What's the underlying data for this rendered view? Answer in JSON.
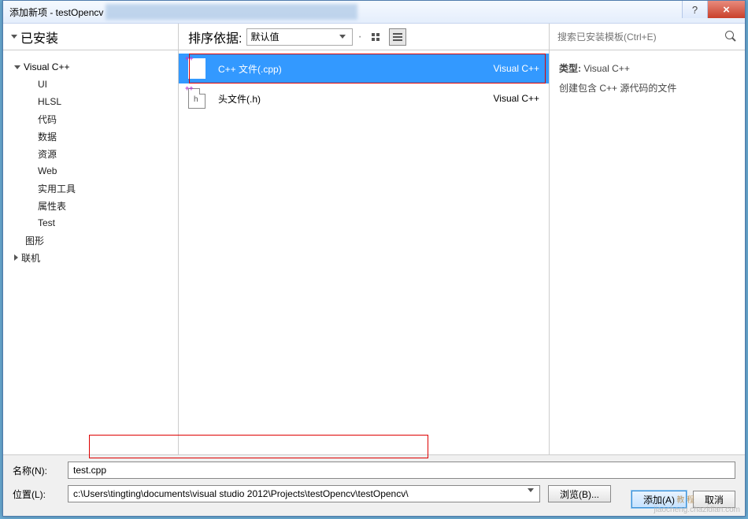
{
  "title": "添加新项 - testOpencv",
  "titlebar": {
    "help": "?",
    "close": "×"
  },
  "toolbar": {
    "installed": "已安装",
    "sort_label": "排序依据:",
    "sort_value": "默认值",
    "search_placeholder": "搜索已安装模板(Ctrl+E)"
  },
  "tree": {
    "root": "Visual C++",
    "items": [
      "UI",
      "HLSL",
      "代码",
      "数据",
      "资源",
      "Web",
      "实用工具",
      "属性表",
      "Test"
    ],
    "siblings": [
      "图形",
      "联机"
    ]
  },
  "templates": [
    {
      "name": "C++ 文件(.cpp)",
      "lang": "Visual C++",
      "selected": true,
      "icon": "cpp"
    },
    {
      "name": "头文件(.h)",
      "lang": "Visual C++",
      "selected": false,
      "icon": "h"
    }
  ],
  "details": {
    "type_label": "类型:",
    "type_value": "Visual C++",
    "description": "创建包含 C++ 源代码的文件"
  },
  "bottom": {
    "name_label": "名称(N):",
    "name_value": "test.cpp",
    "location_label": "位置(L):",
    "location_value": "c:\\Users\\tingting\\documents\\visual studio 2012\\Projects\\testOpencv\\testOpencv\\",
    "browse": "浏览(B)...",
    "add": "添加(A)",
    "cancel": "取消"
  },
  "watermarks": {
    "w1": "教 程",
    "w2": "jiaocheng.chazidian.com"
  }
}
